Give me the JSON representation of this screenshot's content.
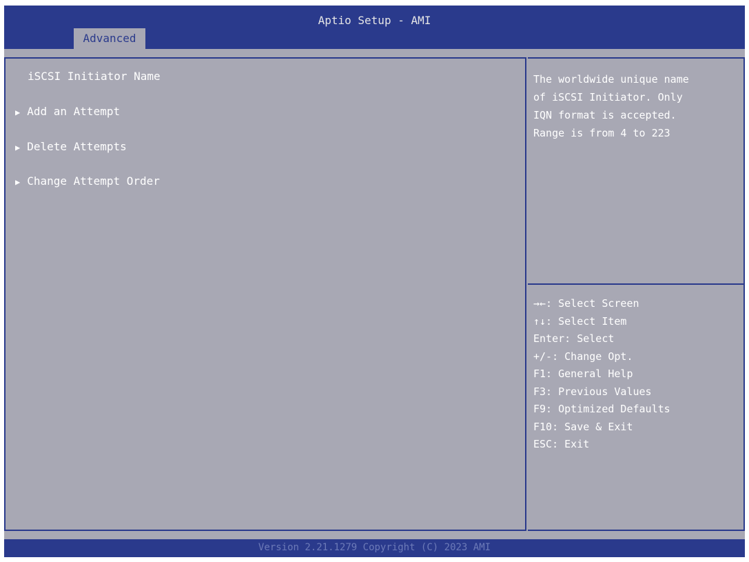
{
  "header": {
    "title": "Aptio Setup - AMI",
    "tabs": [
      {
        "label": "Advanced",
        "active": true
      }
    ]
  },
  "main": {
    "items": [
      {
        "label": "iSCSI Initiator Name",
        "submenu": false
      },
      {
        "label": "Add an Attempt",
        "submenu": true
      },
      {
        "label": "Delete Attempts",
        "submenu": true
      },
      {
        "label": "Change Attempt Order",
        "submenu": true
      }
    ],
    "submenu_arrow": "▶"
  },
  "help": {
    "text": "The worldwide unique name\nof iSCSI Initiator. Only\nIQN format is accepted.\nRange is from 4 to 223"
  },
  "keys": [
    "→←: Select Screen",
    "↑↓: Select Item",
    "Enter: Select",
    "+/-: Change Opt.",
    "F1: General Help",
    "F3: Previous Values",
    "F9: Optimized Defaults",
    "F10: Save & Exit",
    "ESC: Exit"
  ],
  "footer": {
    "version": "Version 2.21.1279 Copyright (C) 2023 AMI"
  },
  "colors": {
    "header_blue": "#2a3a8c",
    "panel_gray": "#a8a8b4",
    "text_white": "#ffffff"
  }
}
